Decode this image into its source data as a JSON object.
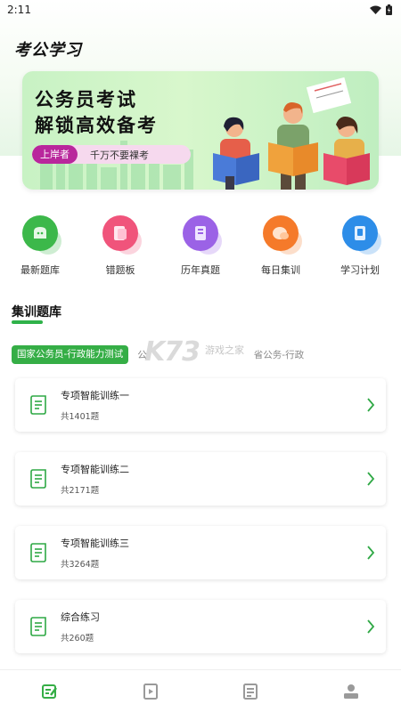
{
  "status_bar": {
    "time": "2:11"
  },
  "app": {
    "title": "考公学习"
  },
  "banner": {
    "line1": "公务员考试",
    "line2": "解锁高效备考",
    "tag_primary": "上岸者",
    "tag_secondary": "千万不要裸考"
  },
  "quick_menu": [
    {
      "label": "最新题库",
      "color": "#3cb84a",
      "icon": "chat-icon"
    },
    {
      "label": "错题板",
      "color": "#f0547b",
      "icon": "note-icon"
    },
    {
      "label": "历年真题",
      "color": "#9b62e6",
      "icon": "document-icon"
    },
    {
      "label": "每日集训",
      "color": "#f57a2a",
      "icon": "bubble-icon"
    },
    {
      "label": "学习计划",
      "color": "#2d8de8",
      "icon": "planner-icon"
    }
  ],
  "section": {
    "title": "集训题库"
  },
  "tabs": {
    "active": "国家公务员-行政能力测试",
    "items": [
      "公",
      "省公务-行政"
    ]
  },
  "watermark": {
    "logo": "K73",
    "sub": "游戏之家"
  },
  "cards": [
    {
      "title": "专项智能训练一",
      "count": "共1401题"
    },
    {
      "title": "专项智能训练二",
      "count": "共2171题"
    },
    {
      "title": "专项智能训练三",
      "count": "共3264题"
    },
    {
      "title": "综合练习",
      "count": "共260题"
    }
  ],
  "bottom_nav": [
    {
      "icon": "practice-icon",
      "active": true
    },
    {
      "icon": "video-icon",
      "active": false
    },
    {
      "icon": "article-icon",
      "active": false
    },
    {
      "icon": "profile-icon",
      "active": false
    }
  ],
  "colors": {
    "accent": "#35ae46",
    "tag_primary": "#b9279c"
  }
}
